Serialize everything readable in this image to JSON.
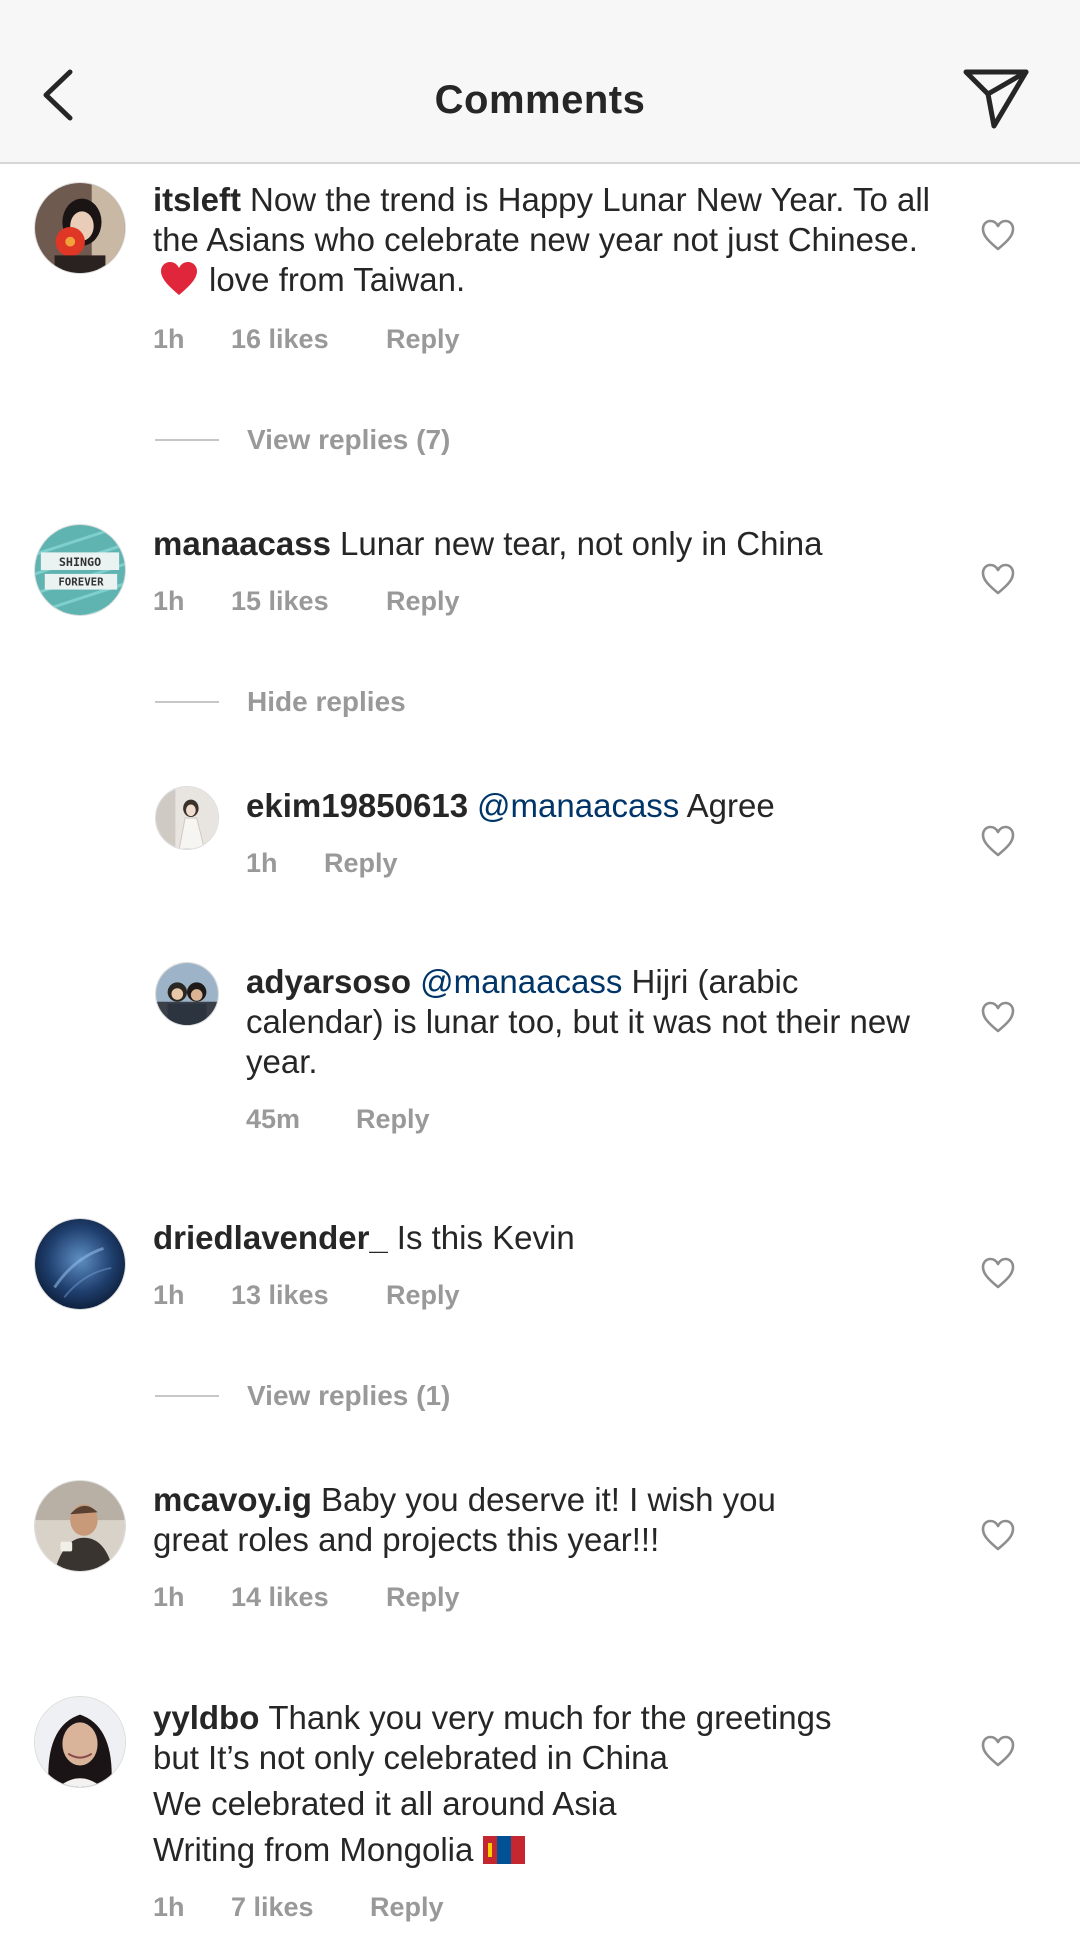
{
  "header": {
    "title": "Comments"
  },
  "comments": [
    {
      "username": "itsleft",
      "text_before_emoji": "Now the trend is Happy Lunar New Year. To all the Asians who celebrate new year not just Chinese.",
      "text_after_emoji": "love from Taiwan.",
      "time": "1h",
      "likes": "16 likes",
      "reply": "Reply",
      "replies_toggle": "View replies (7)"
    },
    {
      "username": "manaacass",
      "text": "Lunar new tear, not only in China",
      "time": "1h",
      "likes": "15 likes",
      "reply": "Reply",
      "replies_toggle": "Hide replies",
      "avatar_text_1": "SHINGO",
      "avatar_text_2": "FOREVER"
    },
    {
      "username": "driedlavender_",
      "text": "Is this Kevin",
      "time": "1h",
      "likes": "13 likes",
      "reply": "Reply",
      "replies_toggle": "View replies (1)"
    },
    {
      "username": "mcavoy.ig",
      "line1": "Baby you deserve it! I wish you",
      "line2": "great roles and projects this year!!!",
      "time": "1h",
      "likes": "14 likes",
      "reply": "Reply"
    },
    {
      "username": "yyldbo",
      "line1": "Thank you very much for the greetings",
      "line2": "but It’s not only celebrated in China",
      "line3": "We celebrated it all around Asia",
      "line4": "Writing from Mongolia",
      "time": "1h",
      "likes": "7 likes",
      "reply": "Reply"
    }
  ],
  "replies": [
    {
      "username": "ekim19850613",
      "mention": "@manaacass",
      "text": "Agree",
      "time": "1h",
      "reply": "Reply"
    },
    {
      "username": "adyarsoso",
      "mention": "@manaacass",
      "text": "Hijri (arabic calendar) is lunar too, but it was not their new year.",
      "time": "45m",
      "reply": "Reply"
    }
  ],
  "colors": {
    "text": "#262626",
    "meta": "#999999",
    "mention": "#003569",
    "header_bg": "#f7f7f7",
    "divider": "#d6d6d6",
    "heart_emoji": "#e0263a"
  },
  "icons": [
    "back-chevron-icon",
    "send-paper-plane-icon",
    "heart-outline-icon",
    "red-heart-emoji",
    "mongolia-flag-emoji"
  ]
}
